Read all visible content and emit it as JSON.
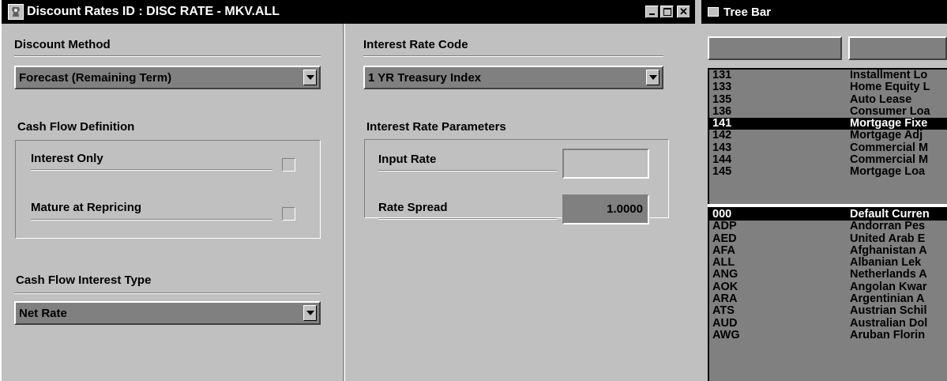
{
  "main_window": {
    "title": "Discount Rates ID : DISC RATE - MKV.ALL",
    "buttons": {
      "minimize": "_",
      "maximize": "□",
      "close": "✕"
    }
  },
  "discount_method": {
    "label": "Discount Method",
    "value": "Forecast (Remaining Term)"
  },
  "cash_flow_definition": {
    "label": "Cash Flow Definition",
    "interest_only": {
      "label": "Interest Only",
      "checked": false
    },
    "mature_at_repricing": {
      "label": "Mature at Repricing",
      "checked": false
    }
  },
  "cash_flow_interest_type": {
    "label": "Cash Flow Interest Type",
    "value": "Net Rate"
  },
  "interest_rate_code": {
    "label": "Interest Rate Code",
    "value": "1 YR Treasury Index"
  },
  "interest_rate_parameters": {
    "label": "Interest Rate Parameters",
    "input_rate": {
      "label": "Input Rate",
      "value": ""
    },
    "rate_spread": {
      "label": "Rate Spread",
      "value": "1.0000"
    }
  },
  "tree_bar": {
    "title": "Tree Bar",
    "search_fields": [
      "",
      ""
    ],
    "products": [
      {
        "code": "131",
        "name": "Installment Lo"
      },
      {
        "code": "133",
        "name": "Home Equity L"
      },
      {
        "code": "135",
        "name": "Auto Lease"
      },
      {
        "code": "136",
        "name": "Consumer Loa"
      },
      {
        "code": "141",
        "name": "Mortgage Fixe",
        "selected": true
      },
      {
        "code": "142",
        "name": "Mortgage  Adj"
      },
      {
        "code": "143",
        "name": "Commercial M"
      },
      {
        "code": "144",
        "name": "Commercial M"
      },
      {
        "code": "145",
        "name": "Mortgage Loa"
      }
    ],
    "currencies": [
      {
        "code": "000",
        "name": "Default Curren",
        "selected": true
      },
      {
        "code": "ADP",
        "name": "Andorran Pes"
      },
      {
        "code": "AED",
        "name": "United Arab E"
      },
      {
        "code": "AFA",
        "name": "Afghanistan A"
      },
      {
        "code": "ALL",
        "name": "Albanian Lek"
      },
      {
        "code": "ANG",
        "name": "Netherlands A"
      },
      {
        "code": "AOK",
        "name": "Angolan Kwar"
      },
      {
        "code": "ARA",
        "name": "Argentinian A"
      },
      {
        "code": "ATS",
        "name": "Austrian Schil"
      },
      {
        "code": "AUD",
        "name": "Australian Dol"
      },
      {
        "code": "AWG",
        "name": "Aruban Florin"
      }
    ]
  }
}
